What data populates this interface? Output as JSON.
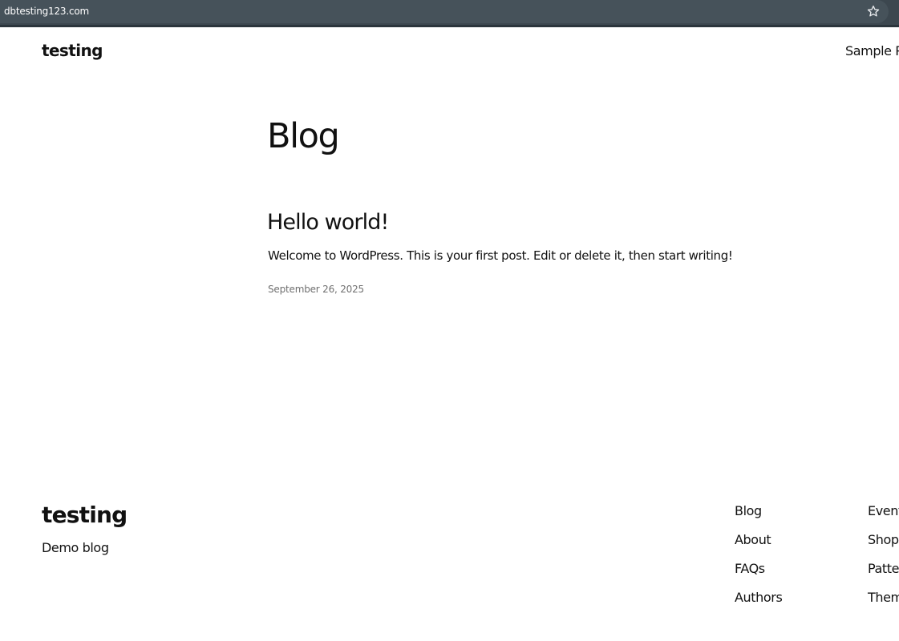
{
  "browser": {
    "url": "dbtesting123.com",
    "bookmark_icon": "star-icon"
  },
  "header": {
    "site_title": "testing",
    "nav": [
      "Sample Pa"
    ]
  },
  "main": {
    "page_title": "Blog",
    "post": {
      "title": "Hello world!",
      "excerpt": "Welcome to WordPress. This is your first post. Edit or delete it, then start writing!",
      "date": "September 26, 2025"
    }
  },
  "footer": {
    "site_title": "testing",
    "tagline": "Demo blog",
    "nav_col1": [
      "Blog",
      "About",
      "FAQs",
      "Authors"
    ],
    "nav_col2": [
      "Events",
      "Shop",
      "Patter",
      "Theme"
    ]
  }
}
